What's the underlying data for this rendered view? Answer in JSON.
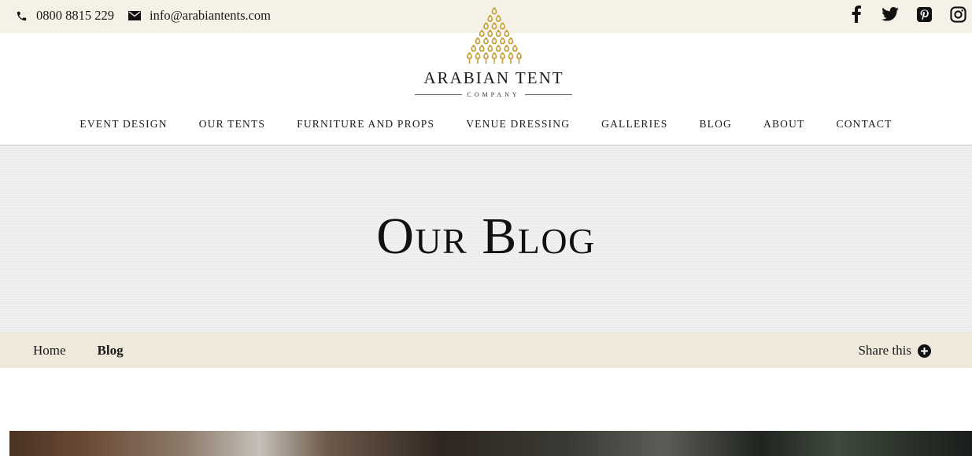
{
  "topbar": {
    "phone": "0800 8815 229",
    "email": "info@arabiantents.com",
    "social": [
      {
        "name": "facebook",
        "icon": "facebook-icon"
      },
      {
        "name": "twitter",
        "icon": "twitter-icon"
      },
      {
        "name": "pinterest",
        "icon": "pinterest-icon"
      },
      {
        "name": "instagram",
        "icon": "instagram-icon"
      }
    ]
  },
  "logo": {
    "name": "ARABIAN TENT",
    "subtitle": "COMPANY",
    "mark_color": "#c9a13b"
  },
  "nav": {
    "items": [
      "EVENT DESIGN",
      "OUR TENTS",
      "FURNITURE AND PROPS",
      "VENUE DRESSING",
      "GALLERIES",
      "BLOG",
      "ABOUT",
      "CONTACT"
    ]
  },
  "hero": {
    "title": "Our Blog"
  },
  "breadcrumb": {
    "home": "Home",
    "current": "Blog",
    "share": "Share this"
  },
  "colors": {
    "topbar_bg": "#f6f1e6",
    "crumb_bg": "#efe9dc",
    "hero_bg": "#f0f0f0",
    "gold": "#c9a13b"
  }
}
